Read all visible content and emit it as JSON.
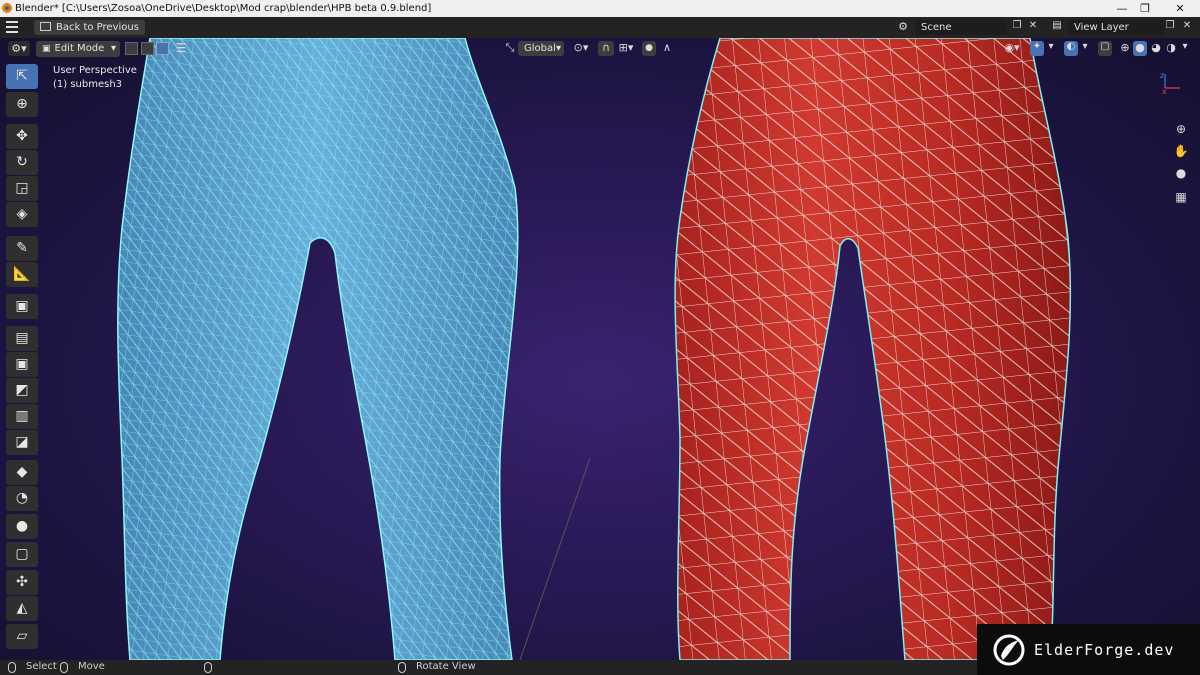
{
  "window": {
    "title": "Blender* [C:\\Users\\Zosoa\\OneDrive\\Desktop\\Mod crap\\blender\\HPB beta 0.9.blend]",
    "controls": {
      "minimize": "—",
      "restore": "❐",
      "close": "✕"
    }
  },
  "topbar": {
    "menu_icon": "hamburger-icon",
    "back_label": "Back to Previous",
    "scene_label": "Scene",
    "view_layer_label": "View Layer"
  },
  "viewport_header": {
    "mode_label": "Edit Mode",
    "orientation_label": "Global",
    "select_modes": [
      "vertex",
      "edge",
      "face"
    ]
  },
  "viewport": {
    "perspective": "User Perspective",
    "object_info": "(1) submesh3",
    "background_color": "#2a1a58",
    "left_mesh_color": "#5aa6d8",
    "right_mesh_color": "#c4302a",
    "wire_color": "#7ef0f0"
  },
  "toolbar": {
    "tools": [
      "select-box",
      "cursor",
      "move",
      "rotate",
      "scale",
      "transform",
      "annotate",
      "measure",
      "add-cube",
      "extrude",
      "inset",
      "bevel",
      "loop-cut",
      "knife",
      "poly-build",
      "spin",
      "smooth",
      "edge-slide",
      "shrink-fatten",
      "shear",
      "rip-region"
    ]
  },
  "navigation": [
    "zoom-icon",
    "pan-hand-icon",
    "camera-icon",
    "grid-view-icon"
  ],
  "statusbar": {
    "select_label": "Select",
    "move_label": "Move",
    "rotate_label": "Rotate View"
  },
  "watermark": {
    "text": "ElderForge.dev"
  }
}
